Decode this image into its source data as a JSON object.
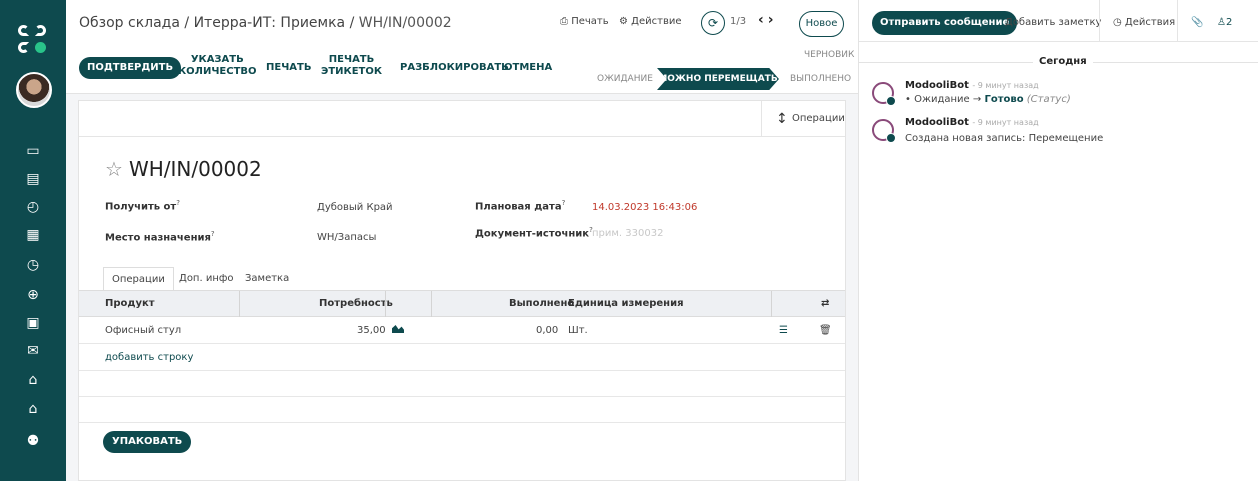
{
  "breadcrumb": {
    "parts": [
      "Обзор склада",
      "Итерра-ИТ: Приемка"
    ],
    "current": "WH/IN/00002",
    "separator": "/"
  },
  "top_actions": {
    "print": "Печать",
    "action": "Действие",
    "pager": "1/3",
    "new": "Новое"
  },
  "buttons": {
    "confirm": "ПОДТВЕРДИТЬ",
    "set_qty": [
      "УКАЗАТЬ",
      "КОЛИЧЕСТВО"
    ],
    "print": "ПЕЧАТЬ",
    "print_labels": [
      "ПЕЧАТЬ",
      "ЭТИКЕТОК"
    ],
    "unlock": "РАЗБЛОКИРОВАТЬ",
    "cancel": "ОТМЕНА",
    "pack": "УПАКОВАТЬ"
  },
  "statusbar": {
    "draft": "ЧЕРНОВИК",
    "waiting": "ОЖИДАНИЕ",
    "ready": "МОЖНО ПЕРЕМЕЩАТЬ",
    "done": "ВЫПОЛНЕНО"
  },
  "sheet": {
    "operations_button": "Операции",
    "title": "WH/IN/00002",
    "fields": {
      "receive_from_label": "Получить от",
      "receive_from_value": "Дубовый Край",
      "destination_label": "Место назначения",
      "destination_value": "WH/Запасы",
      "scheduled_label": "Плановая дата",
      "scheduled_value": "14.03.2023 16:43:06",
      "source_doc_label": "Документ-источник",
      "source_doc_placeholder": "прим. 330032"
    },
    "tabs": [
      "Операции",
      "Доп. инфо",
      "Заметка"
    ],
    "table": {
      "headers": {
        "product": "Продукт",
        "demand": "Потребность",
        "done": "Выполнено",
        "uom": "Единица измерения"
      },
      "rows": [
        {
          "product": "Офисный стул",
          "demand": "35,00",
          "done": "0,00",
          "uom": "Шт."
        }
      ],
      "add_line": "добавить строку"
    }
  },
  "chatter": {
    "send_message": "Отправить сообщение",
    "add_note": "Добавить заметку",
    "activities": "Действия",
    "followers_count": "2",
    "today": "Сегодня",
    "messages": [
      {
        "author": "ModooliBot",
        "time": "- 9 минут назад",
        "from": "Ожидание",
        "to": "Готово",
        "field": "(Статус)"
      },
      {
        "author": "ModooliBot",
        "time": "- 9 минут назад",
        "text": "Создана новая запись: Перемещение"
      }
    ]
  }
}
